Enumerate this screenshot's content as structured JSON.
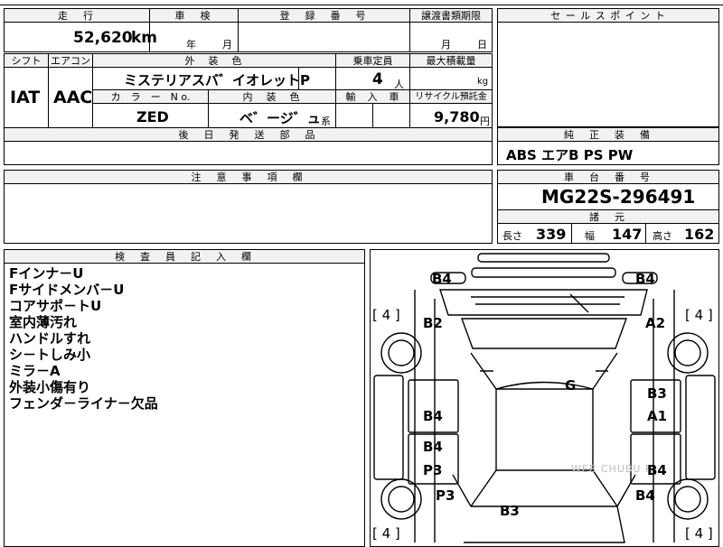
{
  "top": {
    "mileage_header": "走　行",
    "mileage_value": "52,620",
    "mileage_unit": "km",
    "shaken_header": "車　検",
    "shaken_year": "年",
    "shaken_month": "月",
    "reg_header": "登　録　番　号",
    "transfer_header": "譲渡書類期限",
    "transfer_month": "月",
    "transfer_day": "日",
    "sales_point_header": "セ ー ル ス ポ イ ン ト"
  },
  "row2": {
    "shift_header": "シフト",
    "shift_value": "IAT",
    "ac_header": "エアコン",
    "ac_value": "AAC",
    "exterior_header": "外　装　色",
    "exterior_value": "ミステリアスバ゛イオレットP",
    "capacity_header": "乗車定員",
    "capacity_value": "4",
    "capacity_unit": "人",
    "load_header": "最大積載量",
    "load_unit": "kg",
    "color_no_header": "カ　ラ　ー　N o.",
    "color_no_value": "ZED",
    "interior_header": "内　装　色",
    "interior_value": "ベ゛ージ゛ュ",
    "interior_suffix": "系",
    "import_header": "輸　入　車",
    "recycle_header": "リサイクル預託金",
    "recycle_value": "9,780",
    "recycle_unit": "円"
  },
  "options": {
    "later_parts_header": "後　日　発　送　部　品",
    "standard_equipment_header": "純　正　装　備",
    "standard_equipment_value": "ABS エアB PS PW"
  },
  "notes": {
    "caution_header": "注　意　事　項　欄",
    "chassis_header": "車　台　番　号",
    "chassis_value": "MG22S-296491",
    "specs_header": "諸　元",
    "length_label": "長さ",
    "length_value": "339",
    "width_label": "幅",
    "width_value": "147",
    "height_label": "高さ",
    "height_value": "162"
  },
  "inspector": {
    "header": "検　査　員　記　入　欄",
    "lines": [
      "Fインナ－U",
      "Fサイドメンバ－U",
      "コアサポ－トU",
      "室内薄汚れ",
      "ハンドルすれ",
      "シ－トしみ小",
      "ミラ－A",
      "外装小傷有り",
      "フェンダ－ライナ－欠品"
    ]
  },
  "diagram": {
    "damage_marks": [
      "B4",
      "B4",
      "B2",
      "A2",
      "G",
      "B3",
      "B4",
      "A1",
      "B4",
      "P3",
      "B4",
      "P3",
      "B4",
      "B3"
    ],
    "tire_depth_marks": [
      "[ 4 ]",
      "[ 4 ]",
      "[ 4 ]",
      "[ 4 ]"
    ],
    "watermark": "WEB CHUBU P"
  }
}
